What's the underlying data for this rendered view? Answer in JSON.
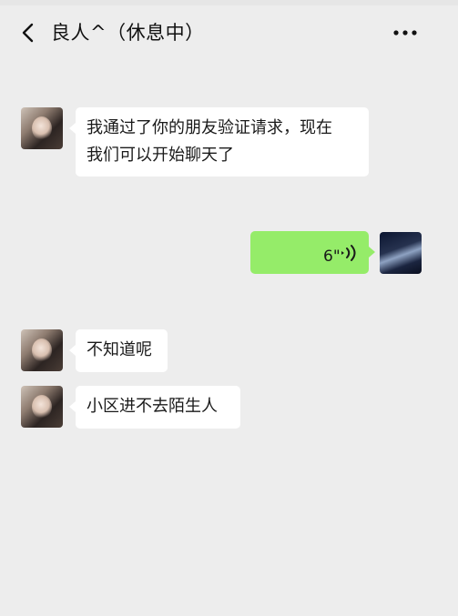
{
  "header": {
    "title": "良人^（休息中）",
    "back_icon": "chevron-left-icon",
    "more_icon": "more-horizontal-icon"
  },
  "colors": {
    "background": "#ededed",
    "incoming_bubble": "#ffffff",
    "outgoing_bubble": "#95ec69"
  },
  "messages": [
    {
      "direction": "incoming",
      "type": "text",
      "text_line1": "我通过了你的朋友验证请求，现在",
      "text_line2": "我们可以开始聊天了"
    },
    {
      "direction": "outgoing",
      "type": "voice",
      "duration": "6\"",
      "icon": "voice-wave-icon"
    },
    {
      "direction": "incoming",
      "type": "text",
      "text": "不知道呢"
    },
    {
      "direction": "incoming",
      "type": "text",
      "text": "小区进不去陌生人"
    }
  ]
}
